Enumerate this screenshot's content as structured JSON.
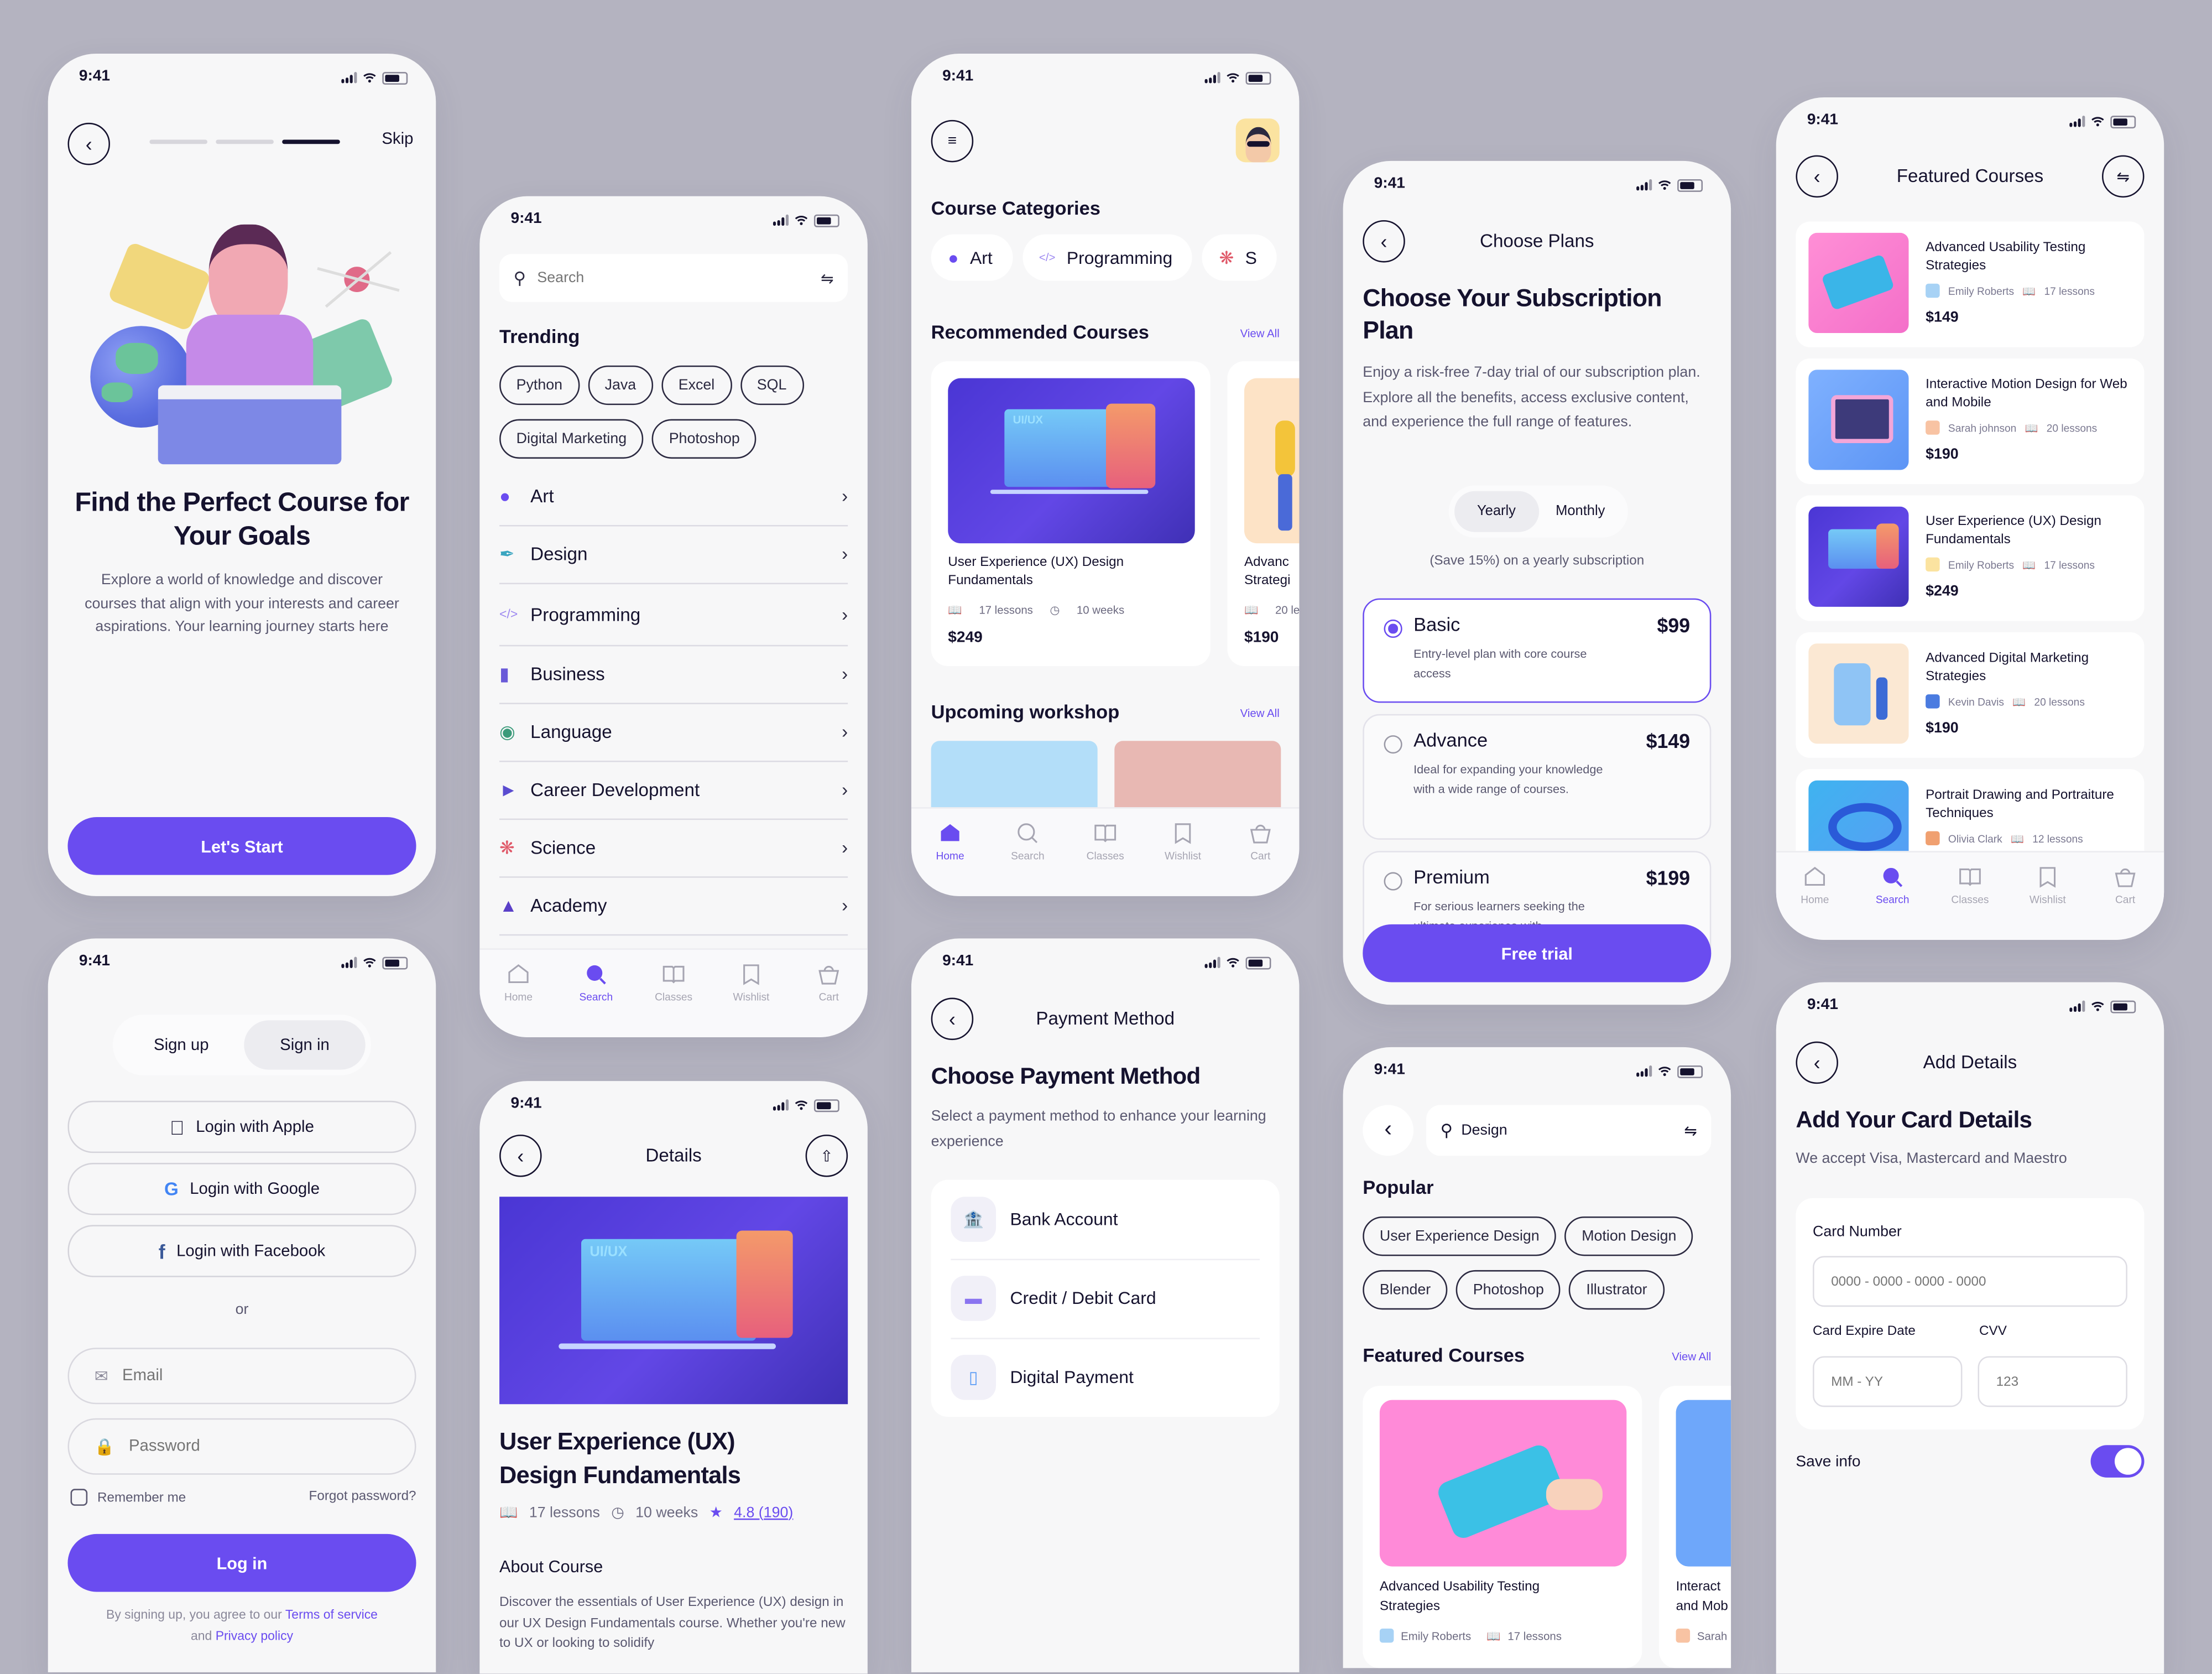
{
  "status_time": "9:41",
  "colors": {
    "accent": "#6a4cf0",
    "text": "#15122e",
    "background": "#b4b3c0",
    "screen": "#f7f7f8"
  },
  "tabbar": {
    "items": [
      {
        "label": "Home",
        "icon": "home-icon"
      },
      {
        "label": "Search",
        "icon": "search-icon"
      },
      {
        "label": "Classes",
        "icon": "book-icon"
      },
      {
        "label": "Wishlist",
        "icon": "bookmark-icon"
      },
      {
        "label": "Cart",
        "icon": "cart-icon"
      }
    ]
  },
  "onboarding": {
    "skip": "Skip",
    "progress_step": 3,
    "progress_total": 3,
    "title": "Find the Perfect Course for Your Goals",
    "description": "Explore a world of knowledge and discover courses that align with your interests and career aspirations. Your learning journey starts here",
    "cta": "Let's Start"
  },
  "search_screen": {
    "search_placeholder": "Search",
    "trending_title": "Trending",
    "trending_tags": [
      "Python",
      "Java",
      "Excel",
      "SQL",
      "Digital Marketing",
      "Photoshop"
    ],
    "categories": [
      {
        "label": "Art",
        "icon": "palette-icon"
      },
      {
        "label": "Design",
        "icon": "pen-tool-icon"
      },
      {
        "label": "Programming",
        "icon": "code-icon"
      },
      {
        "label": "Business",
        "icon": "chart-icon"
      },
      {
        "label": "Language",
        "icon": "globe-icon"
      },
      {
        "label": "Career Development",
        "icon": "megaphone-icon"
      },
      {
        "label": "Science",
        "icon": "atom-icon"
      },
      {
        "label": "Academy",
        "icon": "graduation-cap-icon"
      }
    ],
    "active_tab": "Search"
  },
  "home": {
    "categories_title": "Course Categories",
    "category_chips": [
      "Art",
      "Programming",
      "S"
    ],
    "recommended_title": "Recommended Courses",
    "view_all": "View All",
    "recommended": [
      {
        "title": "User Experience (UX) Design Fundamentals",
        "lessons": "17 lessons",
        "duration": "10 weeks",
        "price": "$249"
      },
      {
        "title": "Advanc Strategi",
        "lessons": "20 les",
        "price": "$190"
      }
    ],
    "workshop_title": "Upcoming workshop",
    "active_tab": "Home"
  },
  "plans": {
    "nav_title": "Choose Plans",
    "title": "Choose Your Subscription Plan",
    "description": "Enjoy a risk-free 7-day trial of our subscription plan. Explore all the benefits, access exclusive content, and experience the full range of features.",
    "toggle": [
      "Yearly",
      "Monthly"
    ],
    "toggle_selected": "Yearly",
    "save_note": "(Save 15%) on a yearly subscription",
    "items": [
      {
        "name": "Basic",
        "price": "$99",
        "desc": "Entry-level plan with core course access",
        "selected": true
      },
      {
        "name": "Advance",
        "price": "$149",
        "desc": "Ideal for expanding your knowledge with a wide range of courses.",
        "selected": false
      },
      {
        "name": "Premium",
        "price": "$199",
        "desc": "For serious learners seeking the ultimate experience with",
        "selected": false
      }
    ],
    "cta": "Free trial"
  },
  "featured": {
    "nav_title": "Featured Courses",
    "courses": [
      {
        "title": "Advanced Usability Testing Strategies",
        "author": "Emily Roberts",
        "lessons": "17 lessons",
        "price": "$149"
      },
      {
        "title": "Interactive Motion Design for Web and Mobile",
        "author": "Sarah johnson",
        "lessons": "20 lessons",
        "price": "$190"
      },
      {
        "title": "User Experience (UX) Design Fundamentals",
        "author": "Emily Roberts",
        "lessons": "17 lessons",
        "price": "$249"
      },
      {
        "title": "Advanced Digital Marketing Strategies",
        "author": "Kevin Davis",
        "lessons": "20 lessons",
        "price": "$190"
      },
      {
        "title": "Portrait Drawing and Portraiture Techniques",
        "author": "Olivia Clark",
        "lessons": "12 lessons",
        "price": ""
      }
    ],
    "active_tab": "Search"
  },
  "signin": {
    "toggle": [
      "Sign up",
      "Sign in"
    ],
    "toggle_selected": "Sign in",
    "apple": "Login with Apple",
    "google": "Login with Google",
    "facebook": "Login with Facebook",
    "or": "or",
    "email_placeholder": "Email",
    "password_placeholder": "Password",
    "remember": "Remember me",
    "forgot": "Forgot password?",
    "login": "Log in",
    "terms_prefix": "By signing up, you agree to our",
    "terms_link": "Terms of service",
    "and": "and",
    "privacy_link": "Privacy policy"
  },
  "details": {
    "nav_title": "Details",
    "title": "User Experience (UX) Design Fundamentals",
    "lessons": "17 lessons",
    "duration": "10 weeks",
    "rating": "4.8 (190)",
    "about_title": "About Course",
    "about_text": "Discover the essentials of User Experience (UX) design in our UX Design Fundamentals course. Whether you're new to UX or looking to solidify"
  },
  "payment": {
    "nav_title": "Payment Method",
    "title": "Choose Payment Method",
    "description": "Select a payment method to enhance your learning experience",
    "methods": [
      {
        "label": "Bank Account",
        "icon": "bank-icon"
      },
      {
        "label": "Credit / Debit Card",
        "icon": "credit-card-icon"
      },
      {
        "label": "Digital Payment",
        "icon": "phone-payment-icon"
      }
    ]
  },
  "search_results": {
    "query": "Design",
    "popular_title": "Popular",
    "popular_tags": [
      "User Experience Design",
      "Motion Design",
      "Blender",
      "Photoshop",
      "Illustrator"
    ],
    "featured_title": "Featured Courses",
    "view_all": "View All",
    "cards": [
      {
        "title": "Advanced Usability Testing Strategies",
        "author": "Emily Roberts",
        "lessons": "17 lessons"
      },
      {
        "title": "Interact and Mob",
        "author": "Sarah"
      }
    ]
  },
  "card_details": {
    "nav_title": "Add Details",
    "title": "Add Your Card Details",
    "subtitle": "We accept Visa, Mastercard and Maestro",
    "card_number_label": "Card Number",
    "card_number_placeholder": "0000 - 0000 - 0000 - 0000",
    "expiry_label": "Card Expire Date",
    "expiry_placeholder": "MM - YY",
    "cvv_label": "CVV",
    "cvv_placeholder": "123",
    "save_info": "Save info",
    "save_info_on": true
  }
}
